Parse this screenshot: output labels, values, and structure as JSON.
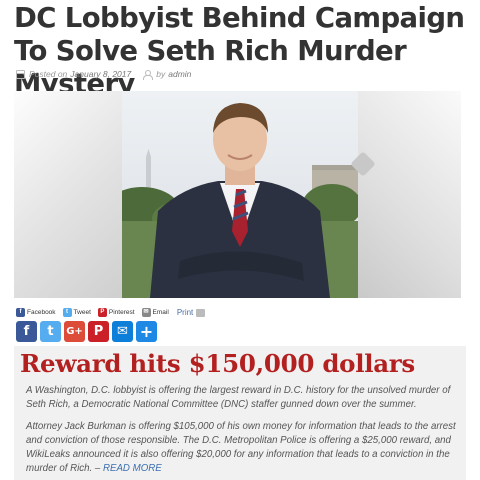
{
  "article": {
    "title": "DC Lobbyist Behind Campaign To Solve Seth Rich Murder Mystery",
    "posted_label": "Posted on",
    "date": "January 8, 2017",
    "by_label": "by",
    "author": "admin"
  },
  "share": {
    "labels": {
      "facebook": "Facebook",
      "tweet": "Tweet",
      "pinterest": "Pinterest",
      "email": "Email",
      "print": "Print"
    },
    "icons": [
      "facebook-icon",
      "twitter-icon",
      "google-plus-icon",
      "pinterest-icon",
      "email-icon",
      "plus-icon"
    ],
    "colors": {
      "facebook": "#3b5998",
      "twitter": "#55acee",
      "google": "#dd4b39",
      "pinterest": "#cb2027",
      "email": "#0d7fd8",
      "addthis": "#1e88e5"
    }
  },
  "body": {
    "headline": "Reward hits $150,000 dollars",
    "paragraph1": "A Washington, D.C. lobbyist is offering the largest reward in D.C. history for the unsolved murder of Seth Rich, a Democratic National Committee (DNC) staffer gunned down over the summer.",
    "paragraph2": "Attorney Jack Burkman is offering $105,000 of his own money for information that leads to the arrest and conviction of those responsible. The D.C. Metropolitan Police is offering a $25,000 reward, and WikiLeaks announced it is also offering $20,000 for any information that leads to a conviction in the murder of Rich. –",
    "read_more": "READ MORE"
  },
  "colors": {
    "headline_red": "#b32020",
    "link_blue": "#3a6fb0"
  }
}
